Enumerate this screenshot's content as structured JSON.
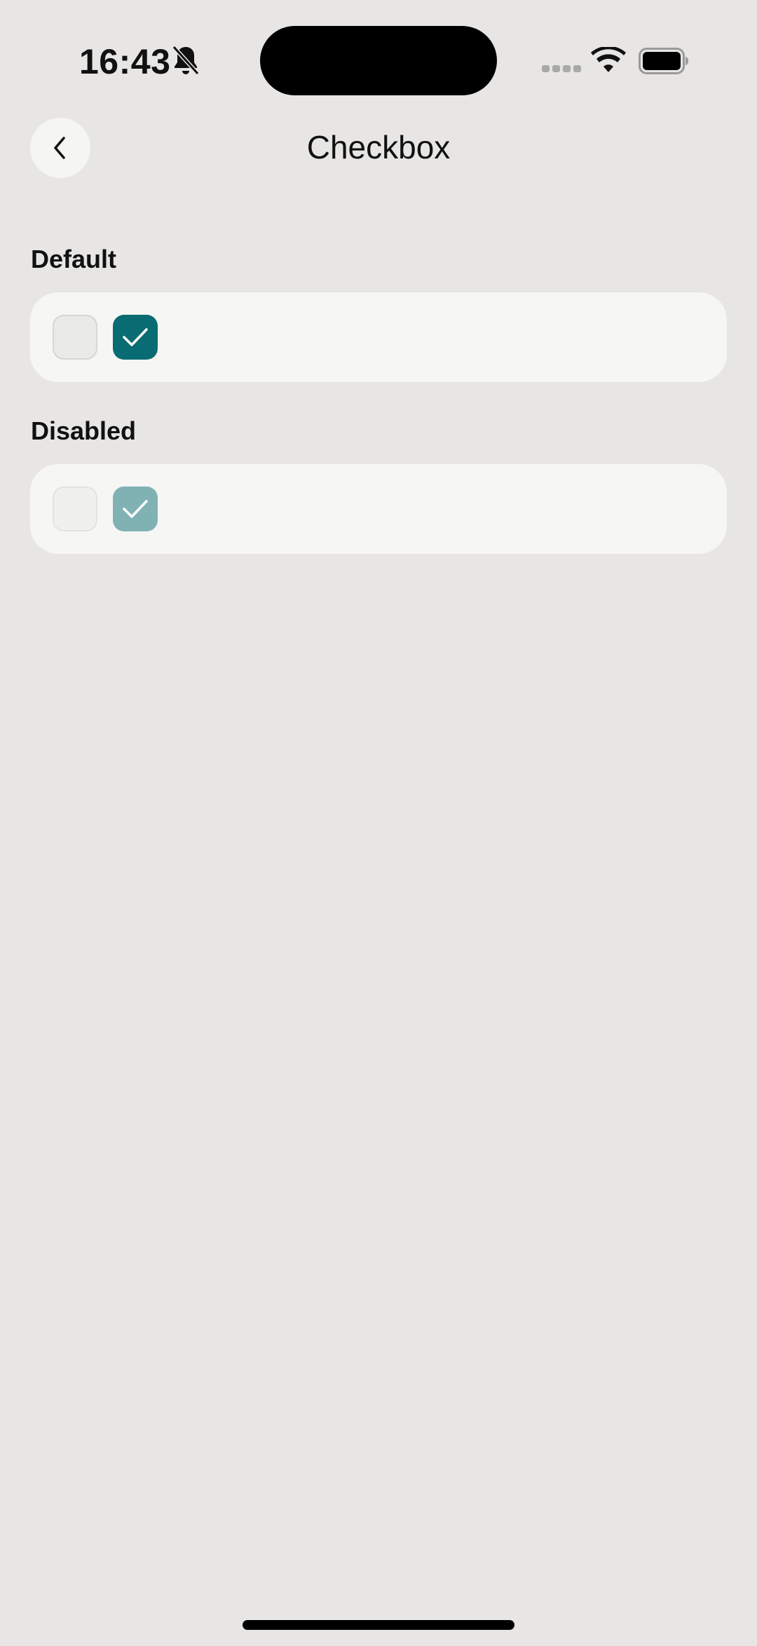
{
  "status_bar": {
    "time": "16:43",
    "icons": [
      "bell-slash-icon",
      "cellular-signal-icon",
      "wifi-icon",
      "battery-icon"
    ]
  },
  "header": {
    "title": "Checkbox",
    "back_icon": "chevron-left-icon"
  },
  "sections": [
    {
      "title": "Default",
      "checkboxes": [
        {
          "checked": false,
          "disabled": false
        },
        {
          "checked": true,
          "disabled": false
        }
      ]
    },
    {
      "title": "Disabled",
      "checkboxes": [
        {
          "checked": false,
          "disabled": true
        },
        {
          "checked": true,
          "disabled": true
        }
      ]
    }
  ],
  "colors": {
    "background": "#e7e6e4",
    "card": "#f6f6f4",
    "accent": "#086c72",
    "accent_disabled": "#80b2b4"
  }
}
